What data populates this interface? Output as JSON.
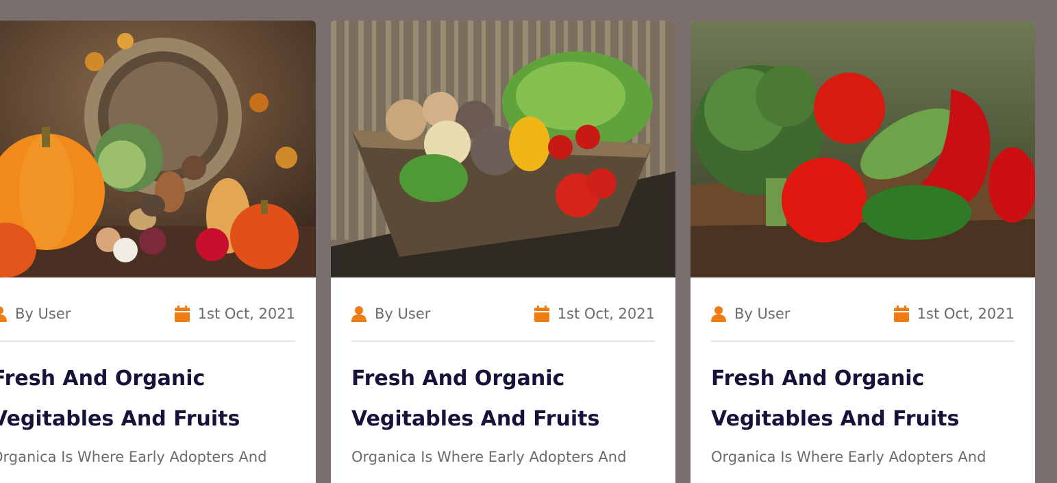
{
  "theme": {
    "accent": "#f07d12",
    "title_color": "#15133a",
    "text_color": "#6b6b6b",
    "background": "#7a6e6f"
  },
  "cards": [
    {
      "image_alt": "Pumpkins and vegetables spilling from a wicker basket",
      "author_icon": "user-icon",
      "author": "By User",
      "date_icon": "calendar-icon",
      "date": "1st Oct, 2021",
      "title_line1": "Fresh And Organic",
      "title_line2": "Vegitables And Fruits",
      "excerpt": "Organica Is Where Early Adopters And"
    },
    {
      "image_alt": "Basket of vegetables with lettuce, beets and tomatoes",
      "author_icon": "user-icon",
      "author": "By User",
      "date_icon": "calendar-icon",
      "date": "1st Oct, 2021",
      "title_line1": "Fresh And Organic",
      "title_line2": "Vegitables And Fruits",
      "excerpt": "Organica Is Where Early Adopters And"
    },
    {
      "image_alt": "Broccoli, tomatoes, cucumber and red peppers on wood",
      "author_icon": "user-icon",
      "author": "By User",
      "date_icon": "calendar-icon",
      "date": "1st Oct, 2021",
      "title_line1": "Fresh And Organic",
      "title_line2": "Vegitables And Fruits",
      "excerpt": "Organica Is Where Early Adopters And"
    }
  ]
}
